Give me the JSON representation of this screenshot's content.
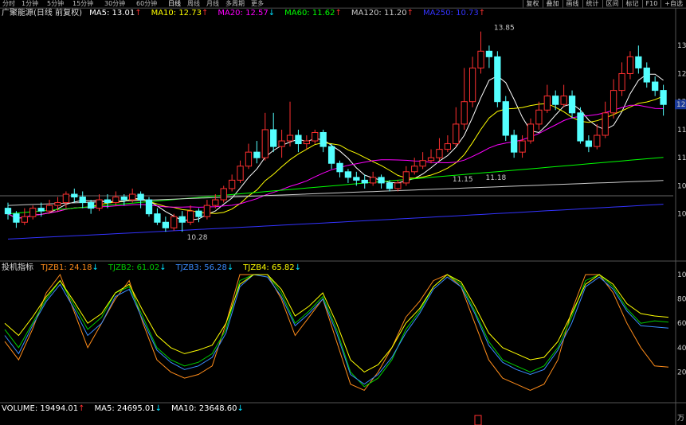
{
  "timeframes": [
    {
      "label": "分时"
    },
    {
      "label": "1分钟"
    },
    {
      "label": "5分钟"
    },
    {
      "label": "15分钟"
    },
    {
      "label": "30分钟"
    },
    {
      "label": "60分钟"
    },
    {
      "label": "日线",
      "active": true
    },
    {
      "label": "周线"
    },
    {
      "label": "月线"
    },
    {
      "label": "多周期"
    },
    {
      "label": "更多"
    }
  ],
  "tools": [
    "复权",
    "叠加",
    "画线",
    "统计",
    "区间",
    "标记",
    "F10",
    "+自选"
  ],
  "stock": {
    "title": "广聚能源(日线 前复权)"
  },
  "ma_legend": [
    {
      "label": "MA5: 13.01",
      "arrow": "↑",
      "color": "#ffffff"
    },
    {
      "label": "MA10: 12.73",
      "arrow": "↑",
      "color": "#ffff00"
    },
    {
      "label": "MA20: 12.57",
      "arrow": "↓",
      "color": "#ff00ff"
    },
    {
      "label": "MA60: 11.62",
      "arrow": "↑",
      "color": "#00ff00"
    },
    {
      "label": "MA120: 11.20",
      "arrow": "↑",
      "color": "#cccccc"
    },
    {
      "label": "MA250: 10.73",
      "arrow": "↑",
      "color": "#3333ff"
    }
  ],
  "indicator_legend": {
    "title": "投机指标",
    "items": [
      {
        "label": "TJZB1: 24.18",
        "arrow": "↓",
        "color": "#ff8c1a"
      },
      {
        "label": "TJZB2: 61.02",
        "arrow": "↓",
        "color": "#00cc00"
      },
      {
        "label": "TJZB3: 56.28",
        "arrow": "↓",
        "color": "#3a8cff"
      },
      {
        "label": "TJZB4: 65.82",
        "arrow": "↓",
        "color": "#ffff00"
      }
    ]
  },
  "volume_legend": {
    "items": [
      {
        "label": "VOLUME: 19494.01",
        "arrow": "↑",
        "color": "#ffffff"
      },
      {
        "label": "MA5: 24695.01",
        "arrow": "↓",
        "color": "#ffffff"
      },
      {
        "label": "MA10: 23648.60",
        "arrow": "↓",
        "color": "#ffffff"
      }
    ]
  },
  "right_axis_labels": {
    "main": [
      "13",
      "12",
      "12",
      "11",
      "11",
      "10",
      "10"
    ],
    "current_price": "12",
    "indicator": [
      "100",
      "80",
      "60",
      "40",
      "20"
    ],
    "volume": "万"
  },
  "chart_data": {
    "type": "candlestick",
    "price_range": [
      9.9,
      14.1
    ],
    "annotations": [
      {
        "text": "13.85",
        "index": 58,
        "value": 13.85
      },
      {
        "text": "10.28",
        "index": 21,
        "value": 10.28
      },
      {
        "text": "11.15",
        "index": 53,
        "value": 11.15
      },
      {
        "text": "11.18",
        "index": 57,
        "value": 11.18
      }
    ],
    "candles": [
      [
        10.7,
        10.6,
        10.8,
        10.5
      ],
      [
        10.6,
        10.45,
        10.65,
        10.35
      ],
      [
        10.45,
        10.55,
        10.7,
        10.4
      ],
      [
        10.55,
        10.7,
        10.75,
        10.5
      ],
      [
        10.7,
        10.65,
        10.8,
        10.55
      ],
      [
        10.65,
        10.75,
        10.85,
        10.6
      ],
      [
        10.75,
        10.8,
        10.9,
        10.65
      ],
      [
        10.8,
        10.95,
        11.0,
        10.7
      ],
      [
        10.95,
        10.9,
        11.05,
        10.8
      ],
      [
        10.9,
        10.8,
        11.0,
        10.7
      ],
      [
        10.8,
        10.7,
        10.85,
        10.6
      ],
      [
        10.7,
        10.85,
        10.95,
        10.65
      ],
      [
        10.85,
        10.8,
        10.95,
        10.7
      ],
      [
        10.8,
        10.9,
        11.0,
        10.75
      ],
      [
        10.9,
        10.85,
        10.95,
        10.75
      ],
      [
        10.85,
        10.95,
        11.05,
        10.8
      ],
      [
        10.95,
        10.85,
        11.0,
        10.7
      ],
      [
        10.85,
        10.6,
        10.9,
        10.55
      ],
      [
        10.6,
        10.45,
        10.7,
        10.4
      ],
      [
        10.45,
        10.35,
        10.55,
        10.28
      ],
      [
        10.35,
        10.55,
        10.6,
        10.3
      ],
      [
        10.55,
        10.45,
        10.65,
        10.28
      ],
      [
        10.45,
        10.65,
        10.75,
        10.4
      ],
      [
        10.65,
        10.55,
        10.7,
        10.45
      ],
      [
        10.55,
        10.75,
        10.85,
        10.5
      ],
      [
        10.75,
        10.85,
        10.95,
        10.7
      ],
      [
        10.85,
        11.05,
        11.1,
        10.8
      ],
      [
        11.05,
        11.2,
        11.3,
        11.0
      ],
      [
        11.2,
        11.45,
        11.55,
        11.15
      ],
      [
        11.45,
        11.7,
        11.85,
        11.4
      ],
      [
        11.7,
        11.6,
        11.9,
        11.5
      ],
      [
        11.6,
        12.1,
        12.4,
        11.55
      ],
      [
        12.1,
        11.8,
        12.4,
        11.7
      ],
      [
        11.8,
        11.9,
        12.1,
        11.6
      ],
      [
        11.9,
        12.0,
        12.6,
        11.8
      ],
      [
        12.0,
        11.85,
        12.1,
        11.7
      ],
      [
        11.85,
        11.9,
        12.0,
        11.75
      ],
      [
        11.9,
        12.05,
        12.1,
        11.85
      ],
      [
        12.05,
        11.8,
        12.1,
        11.7
      ],
      [
        11.8,
        11.5,
        11.85,
        11.4
      ],
      [
        11.5,
        11.35,
        11.55,
        11.25
      ],
      [
        11.35,
        11.25,
        11.4,
        11.15
      ],
      [
        11.25,
        11.2,
        11.35,
        11.1
      ],
      [
        11.2,
        11.15,
        11.3,
        11.05
      ],
      [
        11.15,
        11.25,
        11.35,
        11.1
      ],
      [
        11.25,
        11.15,
        11.3,
        11.05
      ],
      [
        11.15,
        11.05,
        11.2,
        11.0
      ],
      [
        11.05,
        11.15,
        11.2,
        11.0
      ],
      [
        11.15,
        11.35,
        11.45,
        11.1
      ],
      [
        11.35,
        11.45,
        11.6,
        11.3
      ],
      [
        11.45,
        11.55,
        11.7,
        11.4
      ],
      [
        11.55,
        11.6,
        11.75,
        11.5
      ],
      [
        11.6,
        11.75,
        11.95,
        11.55
      ],
      [
        11.75,
        11.85,
        12.0,
        11.7
      ],
      [
        11.85,
        12.2,
        12.5,
        11.8
      ],
      [
        12.2,
        12.6,
        13.2,
        12.1
      ],
      [
        12.6,
        13.2,
        13.4,
        12.5
      ],
      [
        13.2,
        13.5,
        13.85,
        13.1
      ],
      [
        13.5,
        13.4,
        13.6,
        13.2
      ],
      [
        13.4,
        12.6,
        13.5,
        12.5
      ],
      [
        12.6,
        12.0,
        12.7,
        11.9
      ],
      [
        12.0,
        11.7,
        12.1,
        11.6
      ],
      [
        11.7,
        11.9,
        12.0,
        11.6
      ],
      [
        11.9,
        12.2,
        12.3,
        11.85
      ],
      [
        12.2,
        12.45,
        12.6,
        12.1
      ],
      [
        12.45,
        12.7,
        12.9,
        12.4
      ],
      [
        12.7,
        12.55,
        12.8,
        12.45
      ],
      [
        12.55,
        12.7,
        12.9,
        12.5
      ],
      [
        12.7,
        12.4,
        12.8,
        12.3
      ],
      [
        12.4,
        11.9,
        12.5,
        11.85
      ],
      [
        11.9,
        11.8,
        12.0,
        11.7
      ],
      [
        11.8,
        12.0,
        12.2,
        11.75
      ],
      [
        12.0,
        12.4,
        12.6,
        11.95
      ],
      [
        12.4,
        12.8,
        13.0,
        12.3
      ],
      [
        12.8,
        13.1,
        13.3,
        12.7
      ],
      [
        13.1,
        13.4,
        13.5,
        13.0
      ],
      [
        13.4,
        13.2,
        13.6,
        13.1
      ],
      [
        13.2,
        12.95,
        13.3,
        12.85
      ],
      [
        12.95,
        12.8,
        13.05,
        12.7
      ],
      [
        12.8,
        12.55,
        12.9,
        12.35
      ]
    ],
    "indicator_range": [
      0,
      100
    ],
    "indicator_series": [
      {
        "name": "TJZB1",
        "color": "#ff8c1a",
        "values": [
          45,
          30,
          55,
          85,
          100,
          70,
          40,
          60,
          80,
          95,
          60,
          30,
          20,
          15,
          18,
          25,
          60,
          100,
          100,
          100,
          80,
          50,
          65,
          80,
          45,
          10,
          5,
          20,
          40,
          65,
          78,
          95,
          100,
          90,
          60,
          30,
          15,
          10,
          5,
          10,
          30,
          70,
          100,
          100,
          85,
          60,
          40,
          25,
          24
        ]
      },
      {
        "name": "TJZB2",
        "color": "#00cc00",
        "values": [
          55,
          40,
          60,
          80,
          95,
          75,
          55,
          65,
          85,
          90,
          65,
          40,
          30,
          25,
          28,
          35,
          55,
          95,
          100,
          100,
          85,
          60,
          70,
          82,
          55,
          20,
          8,
          15,
          30,
          55,
          70,
          90,
          100,
          92,
          70,
          45,
          30,
          25,
          20,
          25,
          40,
          65,
          95,
          100,
          90,
          72,
          60,
          62,
          61
        ]
      },
      {
        "name": "TJZB3",
        "color": "#3a8cff",
        "values": [
          50,
          35,
          58,
          78,
          92,
          72,
          50,
          60,
          82,
          88,
          62,
          38,
          28,
          22,
          25,
          32,
          52,
          90,
          100,
          98,
          82,
          58,
          68,
          80,
          52,
          18,
          10,
          18,
          32,
          52,
          68,
          88,
          98,
          90,
          68,
          42,
          28,
          22,
          18,
          22,
          38,
          60,
          90,
          98,
          88,
          70,
          58,
          57,
          56
        ]
      },
      {
        "name": "TJZB4",
        "color": "#ffff00",
        "values": [
          60,
          50,
          65,
          82,
          95,
          78,
          60,
          68,
          85,
          92,
          70,
          50,
          40,
          35,
          38,
          42,
          60,
          92,
          100,
          100,
          88,
          66,
          74,
          85,
          60,
          30,
          20,
          26,
          40,
          60,
          72,
          90,
          100,
          94,
          74,
          52,
          40,
          35,
          30,
          32,
          45,
          68,
          92,
          100,
          92,
          76,
          68,
          66,
          65
        ]
      }
    ]
  }
}
